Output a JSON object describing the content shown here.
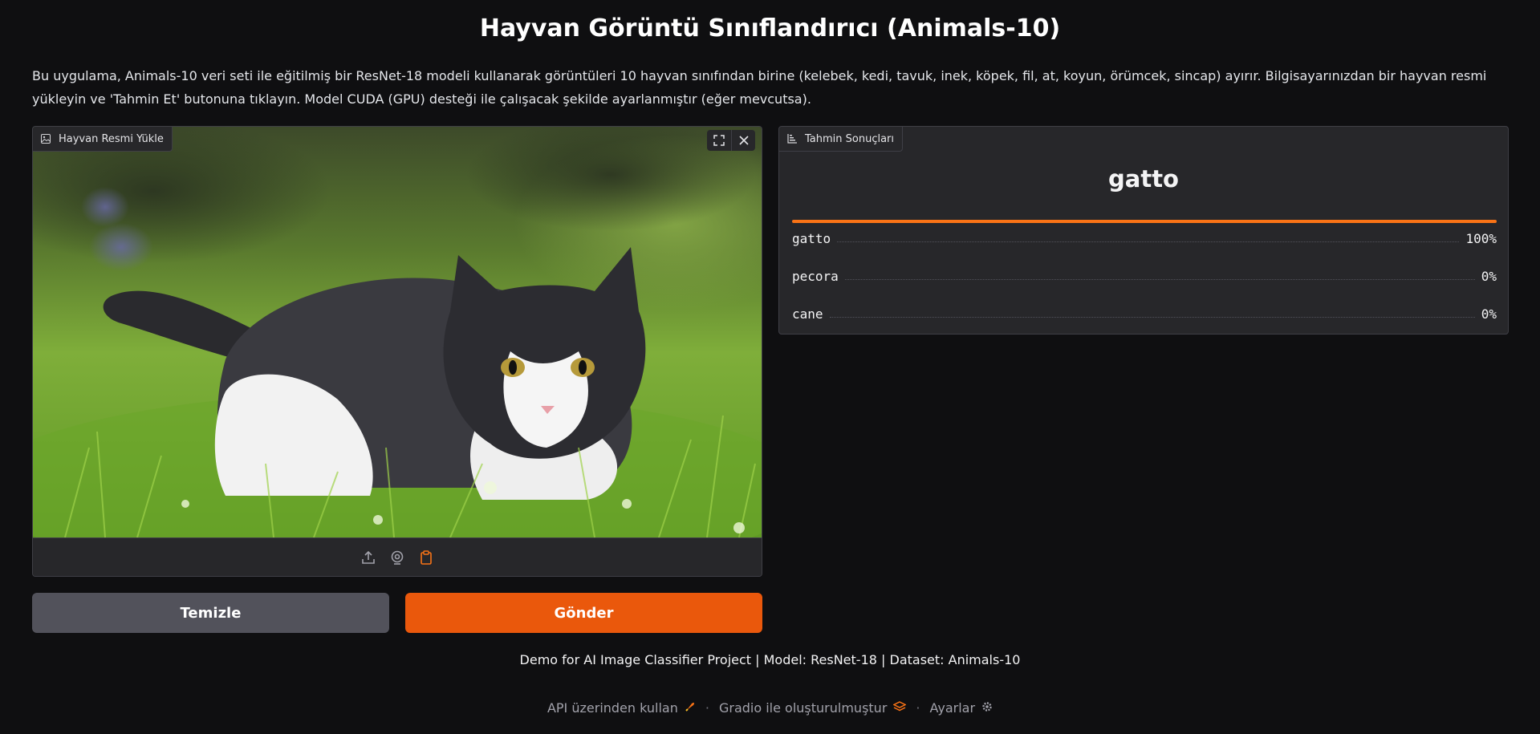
{
  "header": {
    "title": "Hayvan Görüntü Sınıflandırıcı (Animals-10)",
    "description": "Bu uygulama, Animals-10 veri seti ile eğitilmiş bir ResNet-18 modeli kullanarak görüntüleri 10 hayvan sınıfından birine (kelebek, kedi, tavuk, inek, köpek, fil, at, koyun, örümcek, sincap) ayırır. Bilgisayarınızdan bir hayvan resmi yükleyin ve 'Tahmin Et' butonuna tıklayın. Model CUDA (GPU) desteği ile çalışacak şekilde ayarlanmıştır (eğer mevcutsa)."
  },
  "image_input": {
    "label": "Hayvan Resmi Yükle",
    "icon": "image-icon",
    "controls": [
      "fullscreen-icon",
      "close-icon"
    ],
    "sources": [
      "upload-icon",
      "webcam-icon",
      "clipboard-icon"
    ]
  },
  "results": {
    "label": "Tahmin Sonuçları",
    "icon": "bar-chart-icon",
    "top_prediction": "gatto",
    "confidences": [
      {
        "label": "gatto",
        "value_text": "100%",
        "value": 1.0
      },
      {
        "label": "pecora",
        "value_text": "0%",
        "value": 0.0
      },
      {
        "label": "cane",
        "value_text": "0%",
        "value": 0.0
      }
    ]
  },
  "buttons": {
    "clear": "Temizle",
    "submit": "Gönder"
  },
  "footer": {
    "note": "Demo for AI Image Classifier Project | Model: ResNet-18 | Dataset: Animals-10",
    "api_link": "API üzerinden kullan",
    "gradio_link": "Gradio ile oluşturulmuştur",
    "settings_link": "Ayarlar",
    "separator": "·"
  },
  "colors": {
    "accent": "#ea580c",
    "background": "#0f0f11",
    "panel": "#27272a"
  }
}
